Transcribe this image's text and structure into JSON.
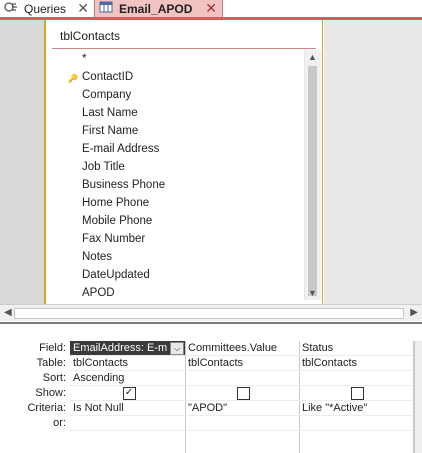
{
  "tabs": [
    {
      "label": "Queries",
      "icon": "queries-icon",
      "close": "✕",
      "active": false
    },
    {
      "label": "Email_APOD",
      "icon": "query-design-icon",
      "close": "✕",
      "active": true
    }
  ],
  "field_list": {
    "title": "tblContacts",
    "items": [
      {
        "label": "*",
        "key": false
      },
      {
        "label": "ContactID",
        "key": true
      },
      {
        "label": "Company",
        "key": false
      },
      {
        "label": "Last Name",
        "key": false
      },
      {
        "label": "First Name",
        "key": false
      },
      {
        "label": "E-mail Address",
        "key": false
      },
      {
        "label": "Job Title",
        "key": false
      },
      {
        "label": "Business Phone",
        "key": false
      },
      {
        "label": "Home Phone",
        "key": false
      },
      {
        "label": "Mobile Phone",
        "key": false
      },
      {
        "label": "Fax Number",
        "key": false
      },
      {
        "label": "Notes",
        "key": false
      },
      {
        "label": "DateUpdated",
        "key": false
      },
      {
        "label": "APOD",
        "key": false
      }
    ]
  },
  "grid": {
    "row_labels": [
      "Field:",
      "Table:",
      "Sort:",
      "Show:",
      "Criteria:",
      "or:"
    ],
    "columns": [
      {
        "field": "EmailAddress: E-m",
        "table": "tblContacts",
        "sort": "Ascending",
        "show": true,
        "criteria": "Is Not Null",
        "or": "",
        "selected": true
      },
      {
        "field": "Committees.Value",
        "table": "tblContacts",
        "sort": "",
        "show": false,
        "criteria": "\"APOD\"",
        "or": "",
        "selected": false
      },
      {
        "field": "Status",
        "table": "tblContacts",
        "sort": "",
        "show": false,
        "criteria": "Like \"*Active\"",
        "or": "",
        "selected": false
      }
    ]
  },
  "colors": {
    "tab_accent": "#d06060",
    "fieldlist_border": "#d8a030",
    "selected_cell": "#3a3a3a"
  }
}
